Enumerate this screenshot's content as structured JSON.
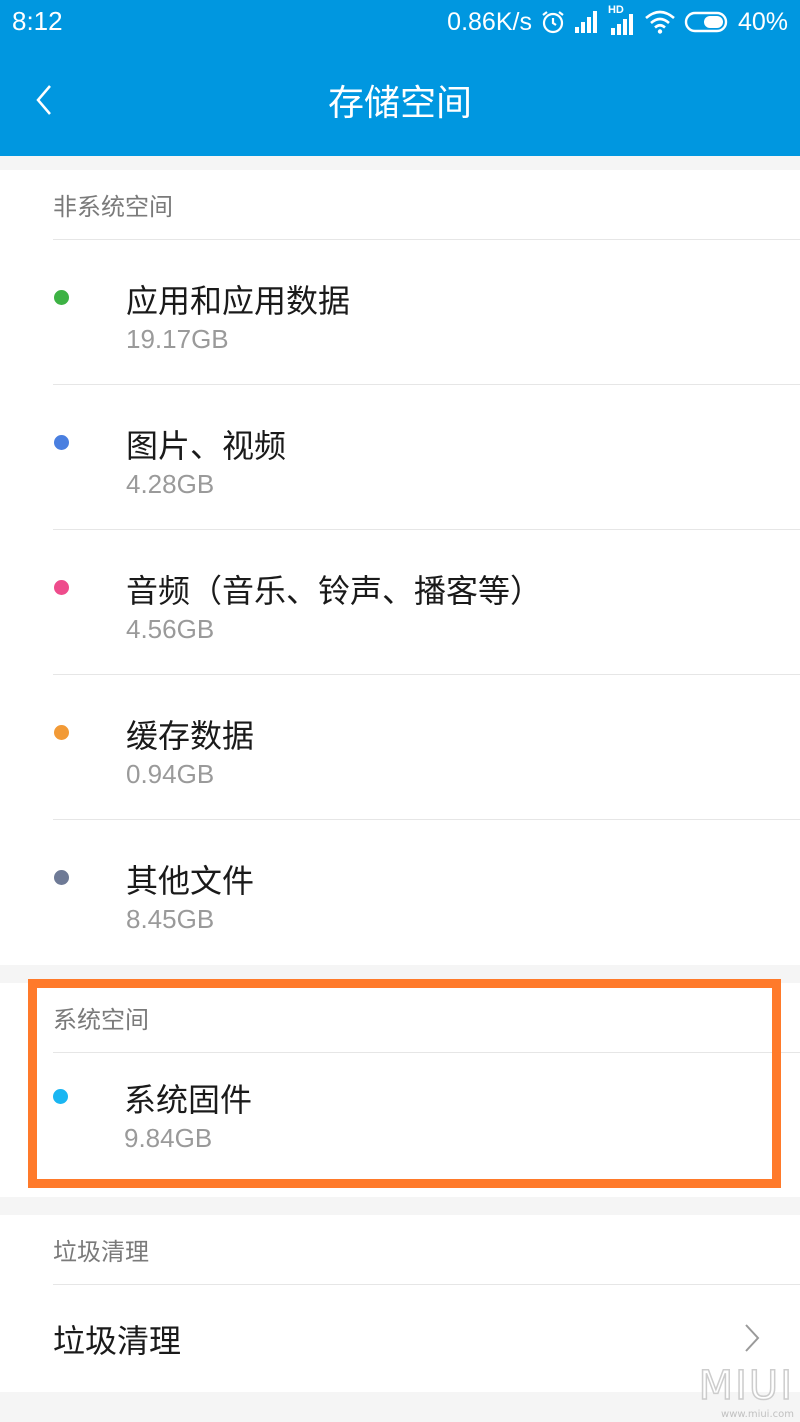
{
  "status_bar": {
    "time": "8:12",
    "speed": "0.86K/s",
    "hd_label": "HD",
    "battery": "40%"
  },
  "header": {
    "title": "存储空间"
  },
  "non_system": {
    "header": "非系统空间",
    "items": [
      {
        "label": "应用和应用数据",
        "size": "19.17GB",
        "color": "#3db244"
      },
      {
        "label": "图片、视频",
        "size": "4.28GB",
        "color": "#4a7fe0"
      },
      {
        "label": "音频（音乐、铃声、播客等）",
        "size": "4.56GB",
        "color": "#ee4c8c"
      },
      {
        "label": "缓存数据",
        "size": "0.94GB",
        "color": "#f29a36"
      },
      {
        "label": "其他文件",
        "size": "8.45GB",
        "color": "#6e7a96"
      }
    ]
  },
  "system": {
    "header": "系统空间",
    "items": [
      {
        "label": "系统固件",
        "size": "9.84GB",
        "color": "#1ab6f2"
      }
    ]
  },
  "cleanup": {
    "header": "垃圾清理",
    "item_label": "垃圾清理"
  },
  "watermark": {
    "logo": "MIUI",
    "site": "www.miui.com"
  },
  "colors": {
    "accent": "#0097e0",
    "highlight": "#ff7a2a"
  },
  "icons": [
    "back-arrow-icon",
    "alarm-icon",
    "signal-icon",
    "wifi-icon",
    "battery-icon",
    "chevron-right-icon"
  ]
}
